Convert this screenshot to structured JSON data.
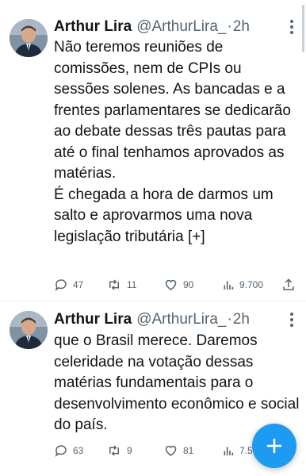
{
  "tweets": [
    {
      "author_name": "Arthur Lira",
      "handle": "@ArthurLira_",
      "separator": "·",
      "time": "2h",
      "paragraphs": [
        "Não teremos reuniões de comissões, nem de CPIs ou sessões solenes. As bancadas e a frentes parlamentares se dedicarão ao debate dessas três pautas para até o final tenhamos aprovados as matérias.",
        "É chegada a hora de darmos um salto e aprovarmos uma nova legislação tributária [+]"
      ],
      "stats": {
        "replies": "47",
        "retweets": "11",
        "likes": "90",
        "views": "9.700"
      }
    },
    {
      "author_name": "Arthur Lira",
      "handle": "@ArthurLira_",
      "separator": "·",
      "time": "2h",
      "paragraphs": [
        "que o Brasil merece. Daremos celeridade na votação dessas matérias fundamentais para o desenvolvimento econômico e social do país."
      ],
      "stats": {
        "replies": "63",
        "retweets": "9",
        "likes": "81",
        "views": "7.53"
      }
    }
  ],
  "icons": {
    "reply": "reply-icon",
    "retweet": "retweet-icon",
    "like": "heart-icon",
    "views": "views-chart-icon",
    "share": "share-icon",
    "compose": "compose-plus-icon",
    "more": "more-options-icon"
  },
  "colors": {
    "accent": "#1d9bf0",
    "muted": "#536471",
    "text": "#0f1419"
  }
}
